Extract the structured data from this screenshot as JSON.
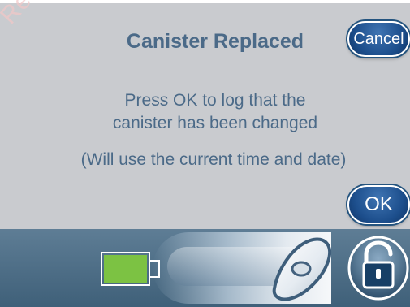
{
  "dialog": {
    "title": "Canister Replaced",
    "message_line1": "Press OK to log that the",
    "message_line2": "canister has been changed",
    "note": "(Will use the current time and date)"
  },
  "buttons": {
    "cancel_label": "Cancel",
    "ok_label": "OK"
  },
  "watermark": {
    "text": "Respons"
  },
  "status": {
    "battery_level": "high",
    "battery_color": "#7cc243",
    "lock_state": "unlocked"
  },
  "icons": {
    "battery": "battery-icon",
    "slider_handle": "slider-handle-icon",
    "lock": "padlock-open-icon"
  },
  "colors": {
    "panel": "#c9cbcf",
    "text": "#4b6a88",
    "button": "#1d4f8d",
    "bottom_bar": "#4f6f88"
  }
}
